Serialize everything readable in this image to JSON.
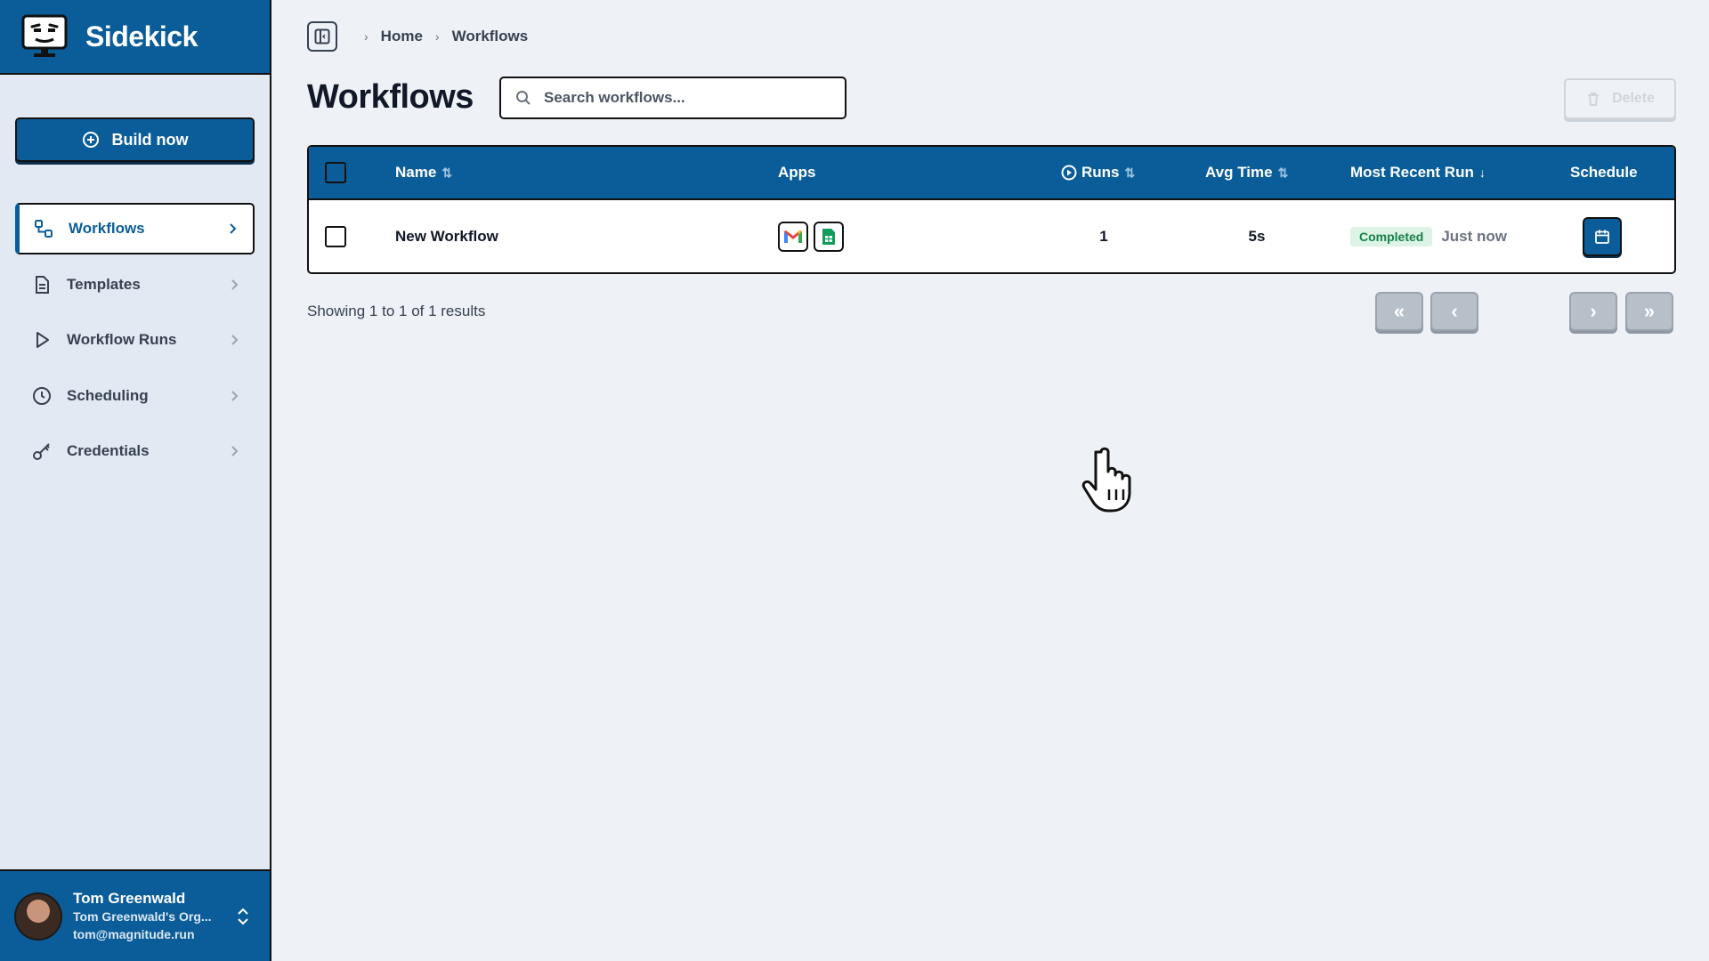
{
  "app": {
    "name": "Sidekick"
  },
  "sidebar": {
    "build_label": "Build now",
    "items": [
      {
        "label": "Workflows",
        "icon": "workflow-icon",
        "active": true
      },
      {
        "label": "Templates",
        "icon": "document-icon"
      },
      {
        "label": "Workflow Runs",
        "icon": "play-icon"
      },
      {
        "label": "Scheduling",
        "icon": "clock-icon"
      },
      {
        "label": "Credentials",
        "icon": "key-icon"
      }
    ],
    "user": {
      "name": "Tom Greenwald",
      "org": "Tom Greenwald's Org...",
      "email": "tom@magnitude.run"
    }
  },
  "breadcrumb": {
    "home": "Home",
    "current": "Workflows"
  },
  "page": {
    "title": "Workflows",
    "search_placeholder": "Search workflows...",
    "delete_label": "Delete"
  },
  "table": {
    "columns": {
      "name": "Name",
      "apps": "Apps",
      "runs": "Runs",
      "avg_time": "Avg Time",
      "recent": "Most Recent Run",
      "schedule": "Schedule"
    },
    "rows": [
      {
        "name": "New Workflow",
        "apps": [
          "gmail-icon",
          "google-sheets-icon"
        ],
        "runs": "1",
        "avg_time": "5s",
        "status": "Completed",
        "recent": "Just now"
      }
    ]
  },
  "pagination": {
    "summary": "Showing 1 to 1 of 1 results",
    "first": "«",
    "prev": "‹",
    "next": "›",
    "last": "»"
  },
  "colors": {
    "brand": "#0b5d99",
    "status_completed_bg": "#dcf3e6",
    "status_completed_text": "#17804a"
  }
}
